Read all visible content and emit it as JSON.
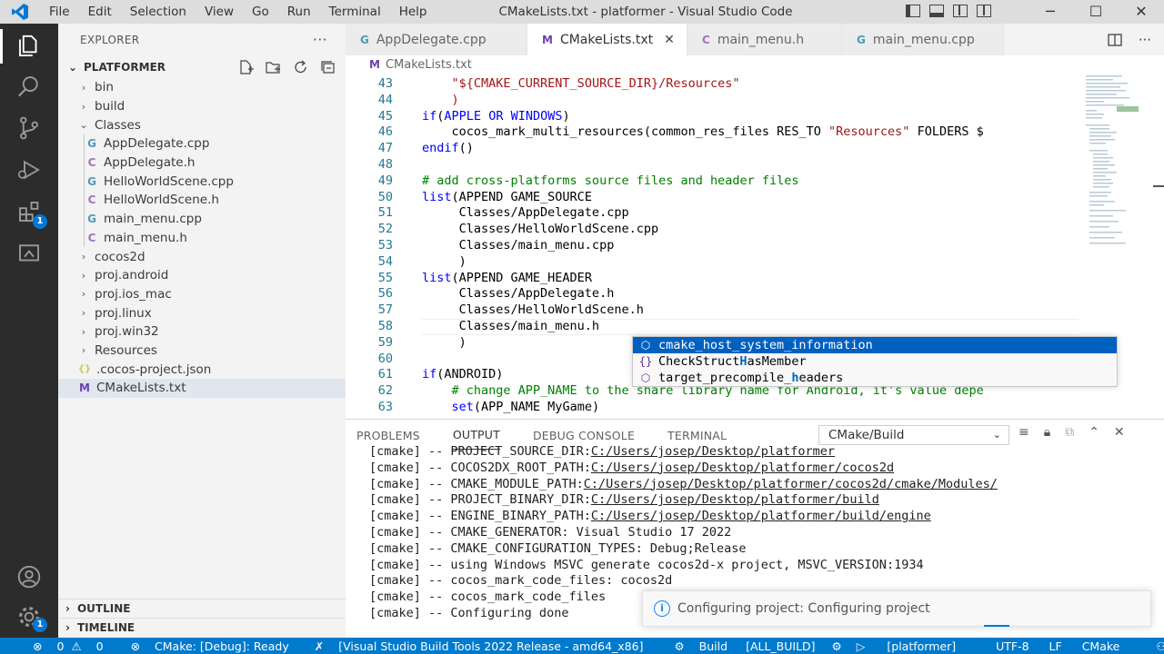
{
  "window": {
    "title": "CMakeLists.txt - platformer - Visual Studio Code",
    "menu": [
      "File",
      "Edit",
      "Selection",
      "View",
      "Go",
      "Run",
      "Terminal",
      "Help"
    ]
  },
  "activity": {
    "extensions_badge": "1",
    "accounts_badge": "1"
  },
  "sidebar": {
    "title": "EXPLORER",
    "more": "···",
    "project": "PLATFORMER",
    "tree": [
      {
        "label": "bin",
        "type": "folder",
        "open": false,
        "indent": 0
      },
      {
        "label": "build",
        "type": "folder",
        "open": false,
        "indent": 0
      },
      {
        "label": "Classes",
        "type": "folder",
        "open": true,
        "indent": 0
      },
      {
        "label": "AppDelegate.cpp",
        "type": "cpp",
        "indent": 1
      },
      {
        "label": "AppDelegate.h",
        "type": "h",
        "indent": 1
      },
      {
        "label": "HelloWorldScene.cpp",
        "type": "cpp",
        "indent": 1
      },
      {
        "label": "HelloWorldScene.h",
        "type": "h",
        "indent": 1
      },
      {
        "label": "main_menu.cpp",
        "type": "cpp",
        "indent": 1
      },
      {
        "label": "main_menu.h",
        "type": "h",
        "indent": 1
      },
      {
        "label": "cocos2d",
        "type": "folder",
        "open": false,
        "indent": 0
      },
      {
        "label": "proj.android",
        "type": "folder",
        "open": false,
        "indent": 0
      },
      {
        "label": "proj.ios_mac",
        "type": "folder",
        "open": false,
        "indent": 0
      },
      {
        "label": "proj.linux",
        "type": "folder",
        "open": false,
        "indent": 0
      },
      {
        "label": "proj.win32",
        "type": "folder",
        "open": false,
        "indent": 0
      },
      {
        "label": "Resources",
        "type": "folder",
        "open": false,
        "indent": 0
      },
      {
        "label": ".cocos-project.json",
        "type": "json",
        "indent": 0
      },
      {
        "label": "CMakeLists.txt",
        "type": "cmake",
        "indent": 0,
        "selected": true
      }
    ],
    "outline": "OUTLINE",
    "timeline": "TIMELINE"
  },
  "tabs": [
    {
      "label": "AppDelegate.cpp",
      "type": "cpp",
      "active": false
    },
    {
      "label": "CMakeLists.txt",
      "type": "cmake",
      "active": true,
      "close": "✕"
    },
    {
      "label": "main_menu.h",
      "type": "h",
      "active": false
    },
    {
      "label": "main_menu.cpp",
      "type": "cpp",
      "active": false
    }
  ],
  "breadcrumb": "CMakeLists.txt",
  "code": [
    {
      "n": "43",
      "html": "    <span class=\"s\">\"${CMAKE_CURRENT_SOURCE_DIR}/Resources\"</span>"
    },
    {
      "n": "44",
      "html": "    <span class=\"s\">)</span>"
    },
    {
      "n": "45",
      "html": "<span class=\"k\">if</span>(<span class=\"k\">APPLE</span> <span class=\"k\">OR</span> <span class=\"k\">WINDOWS</span>)"
    },
    {
      "n": "46",
      "html": "    cocos_mark_multi_resources(common_res_files RES_TO <span class=\"s\">\"Resources\"</span> FOLDERS $"
    },
    {
      "n": "47",
      "html": "<span class=\"k\">endif</span>()"
    },
    {
      "n": "48",
      "html": ""
    },
    {
      "n": "49",
      "html": "<span class=\"c\"># add cross-platforms source files and header files</span>"
    },
    {
      "n": "50",
      "html": "<span class=\"k\">list</span>(APPEND GAME_SOURCE"
    },
    {
      "n": "51",
      "html": "     Classes/AppDelegate.cpp"
    },
    {
      "n": "52",
      "html": "     Classes/HelloWorldScene.cpp"
    },
    {
      "n": "53",
      "html": "     Classes/main_menu.cpp"
    },
    {
      "n": "54",
      "html": "     )"
    },
    {
      "n": "55",
      "html": "<span class=\"k\">list</span>(APPEND GAME_HEADER"
    },
    {
      "n": "56",
      "html": "     Classes/AppDelegate.h"
    },
    {
      "n": "57",
      "html": "     Classes/HelloWorldScene.h"
    },
    {
      "n": "58",
      "html": "     Classes/main_menu.h"
    },
    {
      "n": "59",
      "html": "     )"
    },
    {
      "n": "60",
      "html": ""
    },
    {
      "n": "61",
      "html": "<span class=\"k\">if</span>(ANDROID)"
    },
    {
      "n": "62",
      "html": "    <span class=\"c\"># change APP_NAME to the share library name for Android, it's value depe</span>"
    },
    {
      "n": "63",
      "html": "    <span class=\"k\">set</span>(APP_NAME MyGame)"
    }
  ],
  "suggest": [
    {
      "icon": "⬡",
      "before": "cmake_host_system_information",
      "hl": "",
      "after": "",
      "selected": true
    },
    {
      "icon": "{}",
      "before": "CheckStruct",
      "hl": "H",
      "after": "asMember",
      "selected": false
    },
    {
      "icon": "⬡",
      "before": "target_precompile_",
      "hl": "h",
      "after": "eaders",
      "selected": false
    }
  ],
  "panel": {
    "tabs": [
      "PROBLEMS",
      "OUTPUT",
      "DEBUG CONSOLE",
      "TERMINAL"
    ],
    "active": "OUTPUT",
    "dropdown": "CMake/Build",
    "output": [
      {
        "pre": "[cmake] -- PROJECT_SOURCE_DIR:",
        "link": "C:/Users/josep/Desktop/platformer"
      },
      {
        "pre": "[cmake] -- COCOS2DX_ROOT_PATH:",
        "link": "C:/Users/josep/Desktop/platformer/cocos2d"
      },
      {
        "pre": "[cmake] -- CMAKE_MODULE_PATH:",
        "link": "C:/Users/josep/Desktop/platformer/cocos2d/cmake/Modules/"
      },
      {
        "pre": "[cmake] -- PROJECT_BINARY_DIR:",
        "link": "C:/Users/josep/Desktop/platformer/build"
      },
      {
        "pre": "[cmake] -- ENGINE_BINARY_PATH:",
        "link": "C:/Users/josep/Desktop/platformer/build/engine"
      },
      {
        "pre": "[cmake] -- CMAKE_GENERATOR: Visual Studio 17 2022",
        "link": ""
      },
      {
        "pre": "[cmake] -- CMAKE_CONFIGURATION_TYPES: Debug;Release",
        "link": ""
      },
      {
        "pre": "[cmake] -- using Windows MSVC generate cocos2d-x project, MSVC_VERSION:1934",
        "link": ""
      },
      {
        "pre": "[cmake] -- cocos_mark_code_files: cocos2d",
        "link": ""
      },
      {
        "pre": "[cmake] -- cocos_mark_code_files",
        "link": ""
      },
      {
        "pre": "[cmake] -- Configuring done",
        "link": ""
      }
    ],
    "notification": "Configuring project: Configuring project"
  },
  "statusbar": {
    "errors": "0",
    "warnings": "0",
    "cmake": "CMake: [Debug]: Ready",
    "kit": "[Visual Studio Build Tools 2022 Release - amd64_x86]",
    "build": "Build",
    "target": "[ALL_BUILD]",
    "launch": "[platformer]",
    "encoding": "UTF-8",
    "eol": "LF",
    "language": "CMake"
  },
  "colors": {
    "accent": "#007acc",
    "activity_bg": "#2c2c2c",
    "sidebar_bg": "#f3f3f3",
    "cpp_icon": "#519aba",
    "h_icon": "#a074c4",
    "cmake_icon": "#6c3fb3",
    "json_icon": "#cbcb41"
  }
}
